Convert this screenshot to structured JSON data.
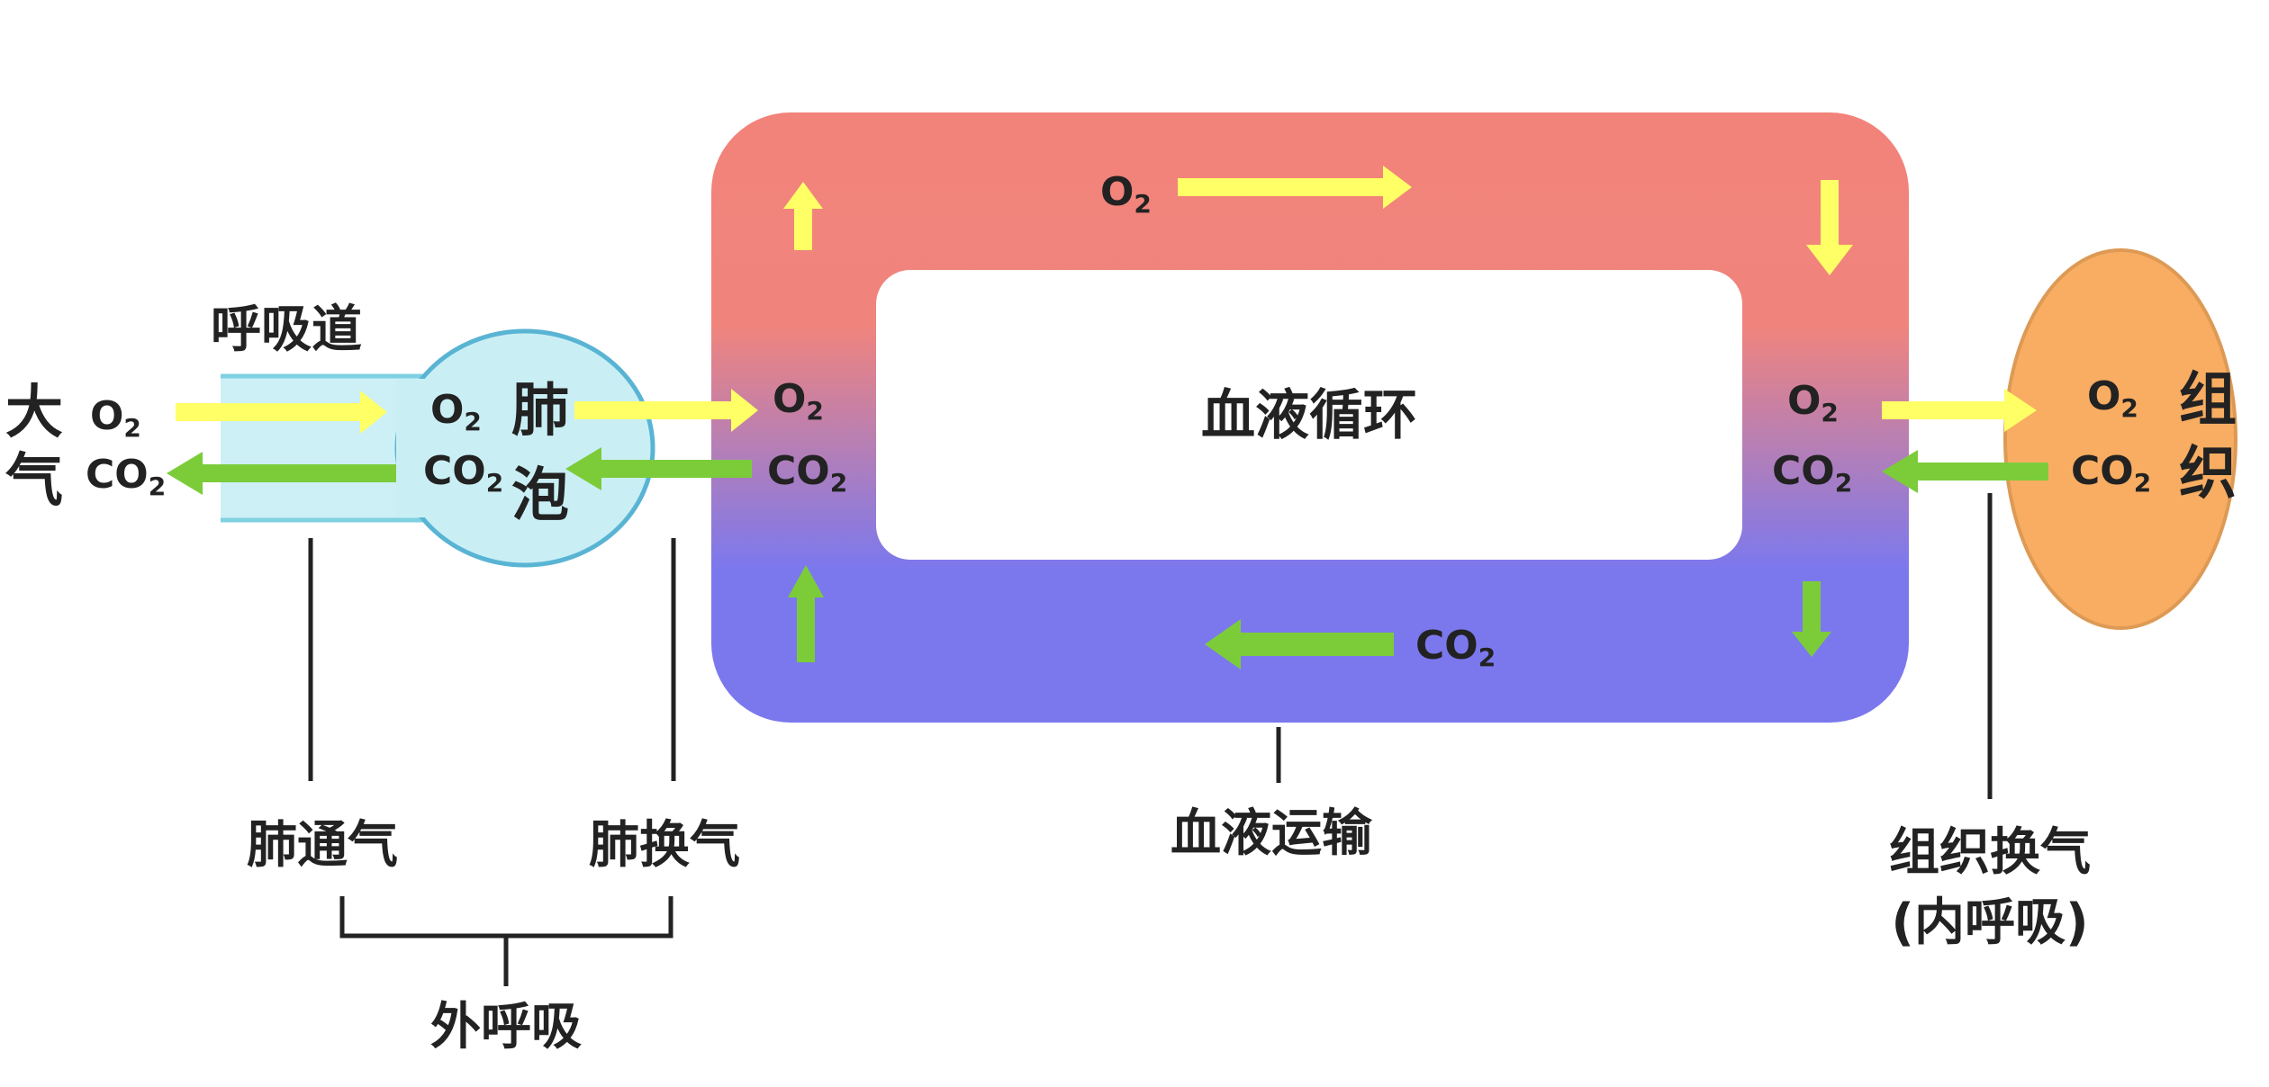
{
  "colors": {
    "oxygen_arrow": "#ffff66",
    "co2_arrow": "#7ccc3a",
    "loop_top": "#f2837a",
    "loop_bottom": "#7b78ee",
    "airway": "#ccf0f6",
    "alveolus": "#c9eff5",
    "tissue": "#f8ad62"
  },
  "labels": {
    "airway": "呼吸道",
    "atmosphere_1": "大",
    "atmosphere_2": "气",
    "alveolus_1": "肺",
    "alveolus_2": "泡",
    "tissue_1": "组",
    "tissue_2": "织",
    "circulation": "血液循环",
    "pulmonary_ventilation": "肺通气",
    "pulmonary_exchange": "肺换气",
    "blood_transport": "血液运输",
    "tissue_exchange": "组织换气",
    "internal_respiration": "(内呼吸)",
    "external_respiration": "外呼吸"
  },
  "chem": {
    "o2_main": "O",
    "o2_sub": "2",
    "co2_main": "CO",
    "co2_sub": "2"
  }
}
